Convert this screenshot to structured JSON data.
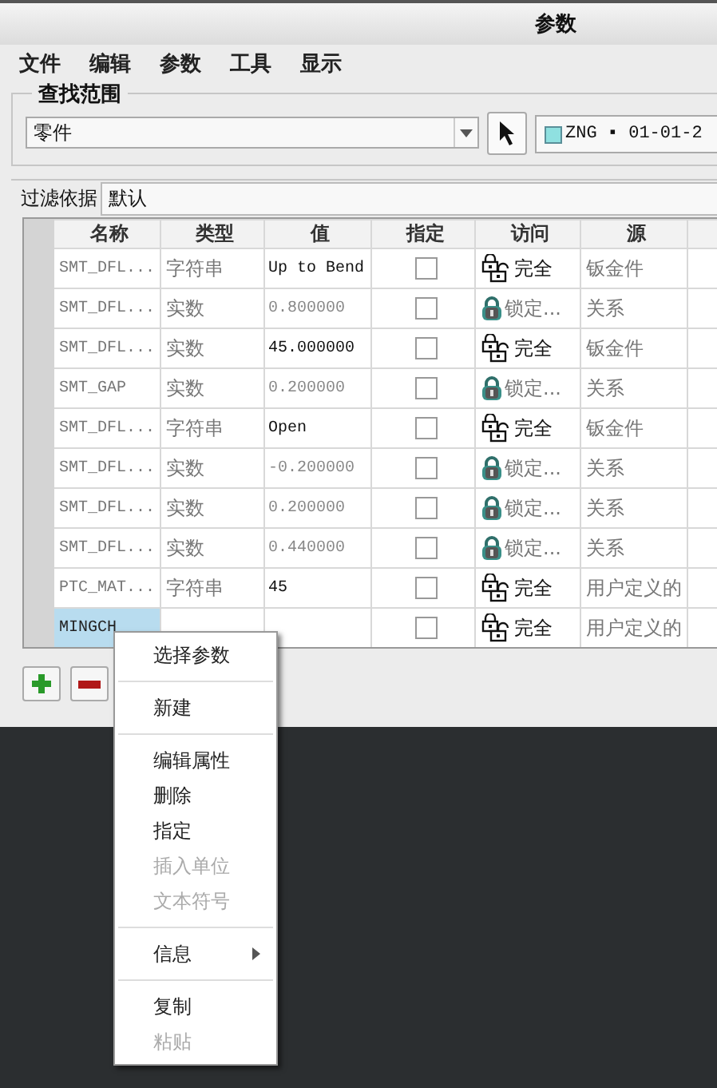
{
  "window": {
    "title": "参数"
  },
  "menu_bar": [
    "文件",
    "编辑",
    "参数",
    "工具",
    "显示"
  ],
  "search_scope": {
    "legend": "查找范围",
    "dropdown": "零件",
    "model": "ZNG ▪ 01-01-2"
  },
  "filter": {
    "label": "过滤依据",
    "value": "默认"
  },
  "table": {
    "columns": [
      "名称",
      "类型",
      "值",
      "指定",
      "访问",
      "源"
    ],
    "rows": [
      {
        "name": "SMT_DFL...",
        "type": "字符串",
        "value": "Up to Bend",
        "checked": false,
        "access": {
          "kind": "full",
          "label": "完全"
        },
        "source": "钣金件",
        "selected": false
      },
      {
        "name": "SMT_DFL...",
        "type": "实数",
        "value": "0.800000",
        "checked": false,
        "access": {
          "kind": "locked",
          "label": "锁定..."
        },
        "source": "关系",
        "selected": false
      },
      {
        "name": "SMT_DFL...",
        "type": "实数",
        "value": "45.000000",
        "checked": false,
        "access": {
          "kind": "full",
          "label": "完全"
        },
        "source": "钣金件",
        "selected": false
      },
      {
        "name": "SMT_GAP",
        "type": "实数",
        "value": "0.200000",
        "checked": false,
        "access": {
          "kind": "locked",
          "label": "锁定..."
        },
        "source": "关系",
        "selected": false
      },
      {
        "name": "SMT_DFL...",
        "type": "字符串",
        "value": "Open",
        "checked": false,
        "access": {
          "kind": "full",
          "label": "完全"
        },
        "source": "钣金件",
        "selected": false
      },
      {
        "name": "SMT_DFL...",
        "type": "实数",
        "value": "-0.200000",
        "checked": false,
        "access": {
          "kind": "locked",
          "label": "锁定..."
        },
        "source": "关系",
        "selected": false
      },
      {
        "name": "SMT_DFL...",
        "type": "实数",
        "value": "0.200000",
        "checked": false,
        "access": {
          "kind": "locked",
          "label": "锁定..."
        },
        "source": "关系",
        "selected": false
      },
      {
        "name": "SMT_DFL...",
        "type": "实数",
        "value": "0.440000",
        "checked": false,
        "access": {
          "kind": "locked",
          "label": "锁定..."
        },
        "source": "关系",
        "selected": false
      },
      {
        "name": "PTC_MAT...",
        "type": "字符串",
        "value": "45",
        "checked": false,
        "access": {
          "kind": "full",
          "label": "完全"
        },
        "source": "用户定义的",
        "selected": false
      },
      {
        "name": "MINGCH",
        "value": "",
        "checked": false,
        "access": {
          "kind": "full",
          "label": "完全"
        },
        "source": "用户定义的",
        "selected": true
      }
    ]
  },
  "context_menu": {
    "groups": [
      [
        {
          "label": "选择参数",
          "disabled": false,
          "submenu": false
        }
      ],
      [
        {
          "label": "新建",
          "disabled": false,
          "submenu": false
        }
      ],
      [
        {
          "label": "编辑属性",
          "disabled": false,
          "submenu": false
        },
        {
          "label": "删除",
          "disabled": false,
          "submenu": false
        },
        {
          "label": "指定",
          "disabled": false,
          "submenu": false
        },
        {
          "label": "插入单位",
          "disabled": true,
          "submenu": false
        },
        {
          "label": "文本符号",
          "disabled": true,
          "submenu": false
        }
      ],
      [
        {
          "label": "信息",
          "disabled": false,
          "submenu": true
        }
      ],
      [
        {
          "label": "复制",
          "disabled": false,
          "submenu": false
        },
        {
          "label": "粘贴",
          "disabled": true,
          "submenu": false
        }
      ]
    ]
  }
}
